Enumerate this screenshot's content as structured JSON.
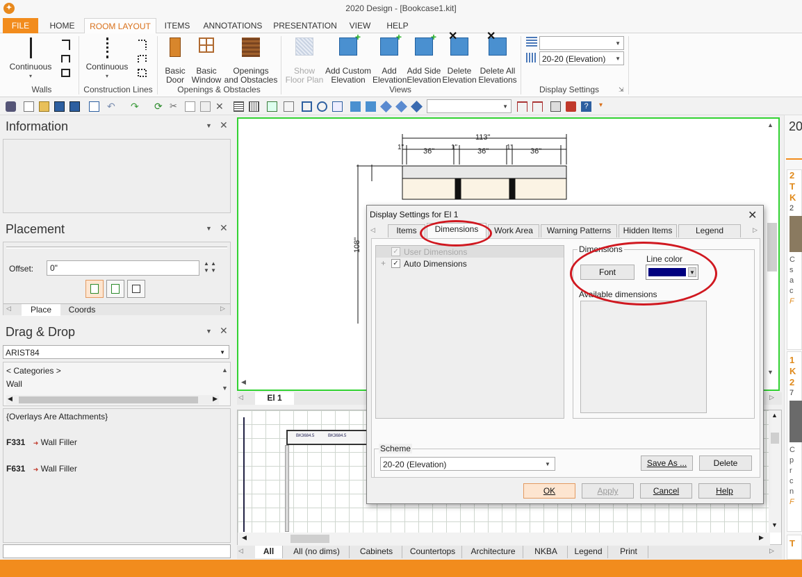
{
  "window": {
    "title": "2020 Design - [Bookcase1.kit]"
  },
  "ribbon_tabs": [
    "FILE",
    "HOME",
    "ROOM LAYOUT",
    "ITEMS",
    "ANNOTATIONS",
    "PRESENTATION",
    "VIEW",
    "HELP"
  ],
  "ribbon": {
    "walls": {
      "button": "Continuous",
      "group": "Walls"
    },
    "construction_lines": {
      "button": "Continuous",
      "group": "Construction Lines"
    },
    "openings": {
      "basic_door": [
        "Basic",
        "Door"
      ],
      "basic_window": [
        "Basic",
        "Window"
      ],
      "openings_obstacles": [
        "Openings",
        "and Obstacles"
      ],
      "group": "Openings & Obstacles"
    },
    "views": {
      "show_floor_plan": [
        "Show",
        "Floor Plan"
      ],
      "add_custom_elevation": [
        "Add Custom",
        "Elevation"
      ],
      "add_elevation": [
        "Add",
        "Elevation"
      ],
      "add_side_elevation": [
        "Add Side",
        "Elevation"
      ],
      "delete_elevation": [
        "Delete",
        "Elevation"
      ],
      "delete_all_elevations": [
        "Delete All",
        "Elevations"
      ],
      "group": "Views"
    },
    "display_settings": {
      "scheme_value": "20-20 (Elevation)",
      "group": "Display Settings"
    }
  },
  "panels": {
    "information": {
      "title": "Information"
    },
    "placement": {
      "title": "Placement",
      "offset_label": "Offset:",
      "offset_value": "0\"",
      "tabs": [
        "Place",
        "Coords"
      ]
    },
    "drag_drop": {
      "title": "Drag & Drop",
      "catalog": "ARIST84",
      "categories": "< Categories >",
      "category_item": "Wall",
      "overlays": "{Overlays Are Attachments}",
      "items": [
        {
          "code": "F331",
          "name": "Wall Filler"
        },
        {
          "code": "F631",
          "name": "Wall Filler"
        }
      ]
    }
  },
  "elevation": {
    "tab_label": "El 1",
    "dimensions": {
      "overall": "113\"",
      "bay": "36\"",
      "gap": "1\"",
      "height": "108\""
    }
  },
  "plan_view": {
    "cabinet_labels": [
      "BK3684.5",
      "BK3684.5"
    ]
  },
  "bottom_tabs": [
    "All",
    "All (no dims)",
    "Cabinets",
    "Countertops",
    "Architecture",
    "NKBA",
    "Legend",
    "Print"
  ],
  "right_panel": {
    "heading": "20",
    "letters": [
      "2",
      "T",
      "K",
      "2",
      "C",
      "s",
      "a",
      "c",
      "F",
      "1",
      "K",
      "2",
      "7",
      "C",
      "p",
      "r",
      "c",
      "n",
      "F",
      "T"
    ]
  },
  "dialog": {
    "title": "Display Settings for El 1",
    "tabs": [
      "Items",
      "Dimensions",
      "Work Area",
      "Warning Patterns",
      "Hidden Items",
      "Legend"
    ],
    "active_tab": "Dimensions",
    "tree": [
      {
        "label": "User Dimensions",
        "checked": true,
        "disabled": true
      },
      {
        "label": "Auto Dimensions",
        "checked": true,
        "disabled": false
      }
    ],
    "dimensions_group": "Dimensions",
    "font_button": "Font",
    "line_color_label": "Line color",
    "line_color": "#00007f",
    "available_label": "Available dimensions",
    "scheme_label": "Scheme",
    "scheme_value": "20-20 (Elevation)",
    "buttons": {
      "save_as": "Save As ...",
      "delete": "Delete",
      "ok": "OK",
      "apply": "Apply",
      "cancel": "Cancel",
      "help": "Help"
    }
  },
  "colors": {
    "accent": "#f28c1d",
    "active_tab_text": "#d9701a",
    "selection_green": "#32d232",
    "highlight_red": "#d01820"
  }
}
